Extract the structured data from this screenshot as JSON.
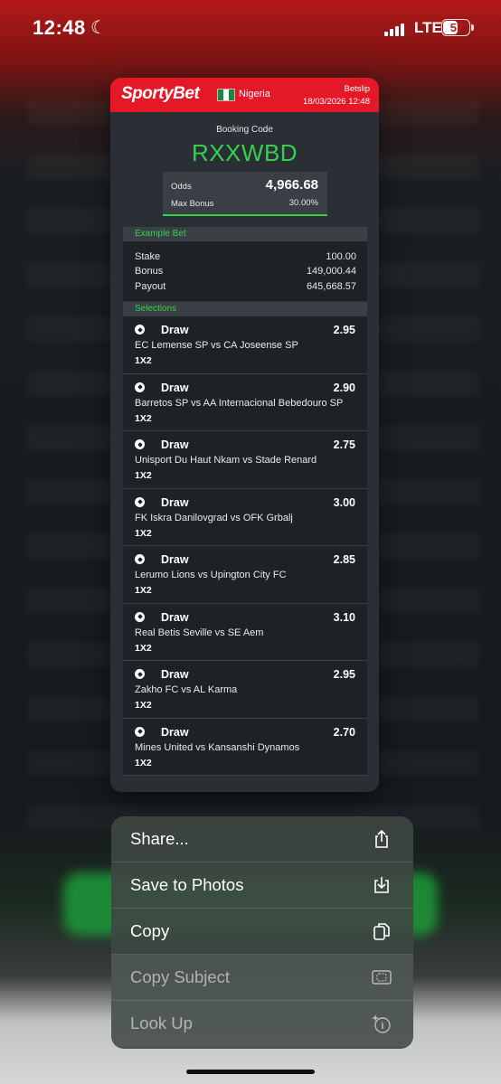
{
  "status_bar": {
    "time": "12:48",
    "network": "LTE",
    "battery": "57"
  },
  "betslip": {
    "brand": "SportyBet",
    "country": "Nigeria",
    "title": "Betslip",
    "date": "18/03/2026 12:48",
    "booking_label": "Booking Code",
    "booking_code": "RXXWBD",
    "odds_label": "Odds",
    "odds_value": "4,966.68",
    "max_bonus_label": "Max Bonus",
    "max_bonus_value": "30.00%",
    "example_bet_label": "Example Bet",
    "stake_label": "Stake",
    "stake_value": "100.00",
    "bonus_label": "Bonus",
    "bonus_value": "149,000.44",
    "payout_label": "Payout",
    "payout_value": "645,668.57",
    "selections_label": "Selections",
    "selections": [
      {
        "pick": "Draw",
        "odds": "2.95",
        "match": "EC Lemense SP vs CA Joseense SP",
        "market": "1X2"
      },
      {
        "pick": "Draw",
        "odds": "2.90",
        "match": "Barretos SP vs AA Internacional Bebedouro SP",
        "market": "1X2"
      },
      {
        "pick": "Draw",
        "odds": "2.75",
        "match": "Unisport Du Haut Nkam vs Stade Renard",
        "market": "1X2"
      },
      {
        "pick": "Draw",
        "odds": "3.00",
        "match": "FK Iskra Danilovgrad vs OFK Grbalj",
        "market": "1X2"
      },
      {
        "pick": "Draw",
        "odds": "2.85",
        "match": "Lerumo Lions vs Upington City FC",
        "market": "1X2"
      },
      {
        "pick": "Draw",
        "odds": "3.10",
        "match": "Real Betis Seville vs SE Aem",
        "market": "1X2"
      },
      {
        "pick": "Draw",
        "odds": "2.95",
        "match": "Zakho FC vs AL Karma",
        "market": "1X2"
      },
      {
        "pick": "Draw",
        "odds": "2.70",
        "match": "Mines United vs Kansanshi Dynamos",
        "market": "1X2"
      }
    ]
  },
  "context_menu": {
    "items": [
      {
        "label": "Share...",
        "icon": "share-icon",
        "enabled": true
      },
      {
        "label": "Save to Photos",
        "icon": "save-download-icon",
        "enabled": true
      },
      {
        "label": "Copy",
        "icon": "copy-icon",
        "enabled": true
      },
      {
        "label": "Copy Subject",
        "icon": "copy-subject-icon",
        "enabled": false
      },
      {
        "label": "Look Up",
        "icon": "look-up-icon",
        "enabled": false
      }
    ]
  },
  "colors": {
    "brand_red": "#e41827",
    "accent_green": "#35d14e",
    "card_bg": "#2a2e35"
  }
}
